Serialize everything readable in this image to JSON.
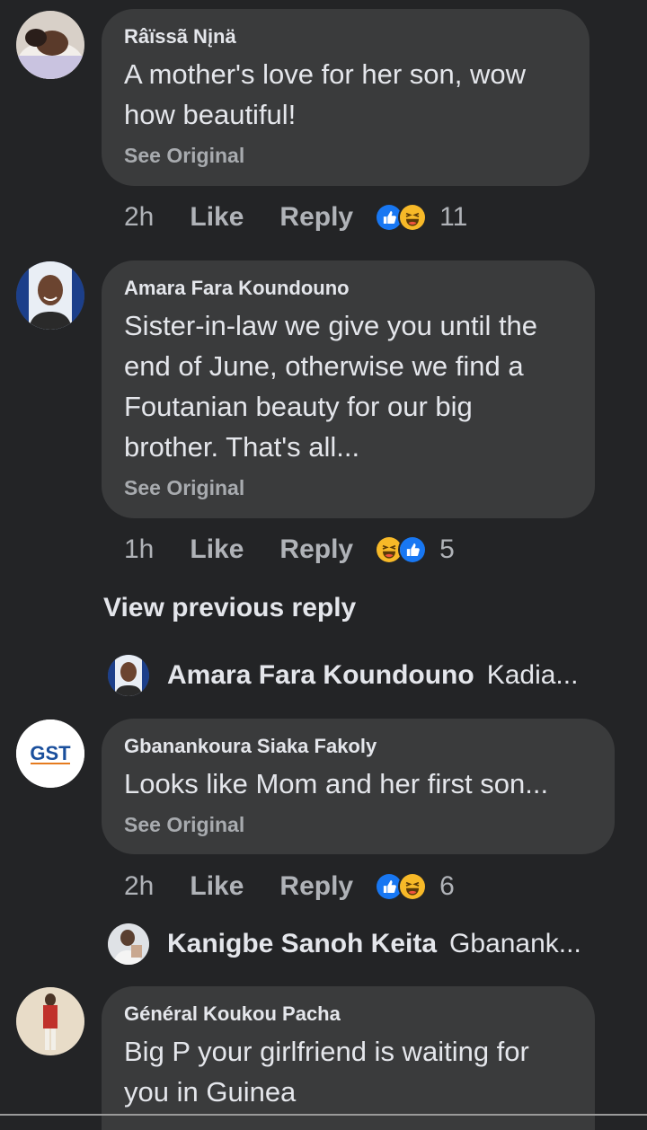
{
  "comments": [
    {
      "author": "Râïssã Nįnä",
      "text_lines": [
        "A mother's love for her son, wow",
        "how beautiful!"
      ],
      "see_original": "See Original",
      "time": "2h",
      "like": "Like",
      "reply": "Reply",
      "reactions": [
        "like-reaction-icon",
        "haha-reaction-icon"
      ],
      "reaction_count": "11"
    },
    {
      "author": "Amara Fara Koundouno",
      "text_lines": [
        "Sister-in-law we give you until the",
        "end of June, otherwise we find a",
        "Foutanian beauty for our big",
        "brother. That's all..."
      ],
      "see_original": "See Original",
      "time": "1h",
      "like": "Like",
      "reply": "Reply",
      "reactions": [
        "haha-reaction-icon",
        "like-reaction-icon"
      ],
      "reaction_count": "5"
    },
    {
      "author": "Gbanankoura Siaka Fakoly",
      "text_lines": [
        "Looks like Mom and her first son..."
      ],
      "see_original": "See Original",
      "time": "2h",
      "like": "Like",
      "reply": "Reply",
      "reactions": [
        "like-reaction-icon",
        "haha-reaction-icon"
      ],
      "reaction_count": "6"
    },
    {
      "author": "Général Koukou Pacha",
      "text_lines": [
        "Big P your girlfriend is waiting for",
        "you in Guinea"
      ]
    }
  ],
  "view_previous_reply": "View previous reply",
  "replies": [
    {
      "name": "Amara Fara Koundouno",
      "preview": "Kadia..."
    },
    {
      "name": "Kanigbe Sanoh Keita",
      "preview": "Gbanank..."
    }
  ],
  "avatar_logo_text": "GST",
  "colors": {
    "background": "#232426",
    "bubble": "#3a3b3c",
    "like_blue": "#1877f2",
    "haha_yellow": "#f7b928"
  }
}
